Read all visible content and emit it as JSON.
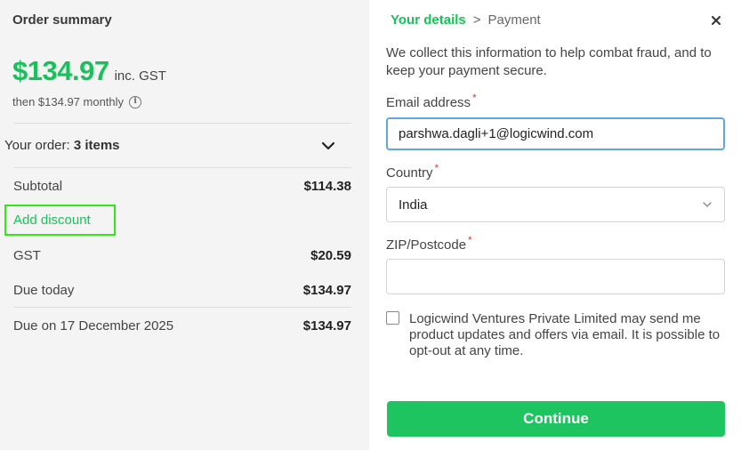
{
  "summary": {
    "title": "Order summary",
    "price": "$134.97",
    "price_suffix": "inc. GST",
    "monthly": "then $134.97 monthly",
    "info_icon_glyph": "i",
    "your_order_prefix": "Your order: ",
    "your_order_items": "3 items",
    "rows": [
      {
        "label": "Subtotal",
        "value": "$114.38"
      },
      {
        "label": "GST",
        "value": "$20.59"
      },
      {
        "label": "Due today",
        "value": "$134.97"
      },
      {
        "label": "Due on 17 December 2025",
        "value": "$134.97"
      }
    ],
    "add_discount": "Add discount"
  },
  "form": {
    "breadcrumb": {
      "active": "Your details",
      "separator": ">",
      "next": "Payment"
    },
    "intro": "We collect this information to help combat fraud, and to keep your payment secure.",
    "email_label": "Email address",
    "email_value": "parshwa.dagli+1@logicwind.com",
    "country_label": "Country",
    "country_value": "India",
    "zip_label": "ZIP/Postcode",
    "zip_value": "",
    "required_mark": "*",
    "consent": "Logicwind Ventures Private Limited may send me product updates and offers via email. It is possible to opt-out at any time.",
    "continue_label": "Continue"
  },
  "colors": {
    "accent": "#19c15a",
    "button": "#1ec460",
    "highlight": "#33e61a",
    "focus": "#5fa7e0",
    "required": "#e23b3b"
  }
}
